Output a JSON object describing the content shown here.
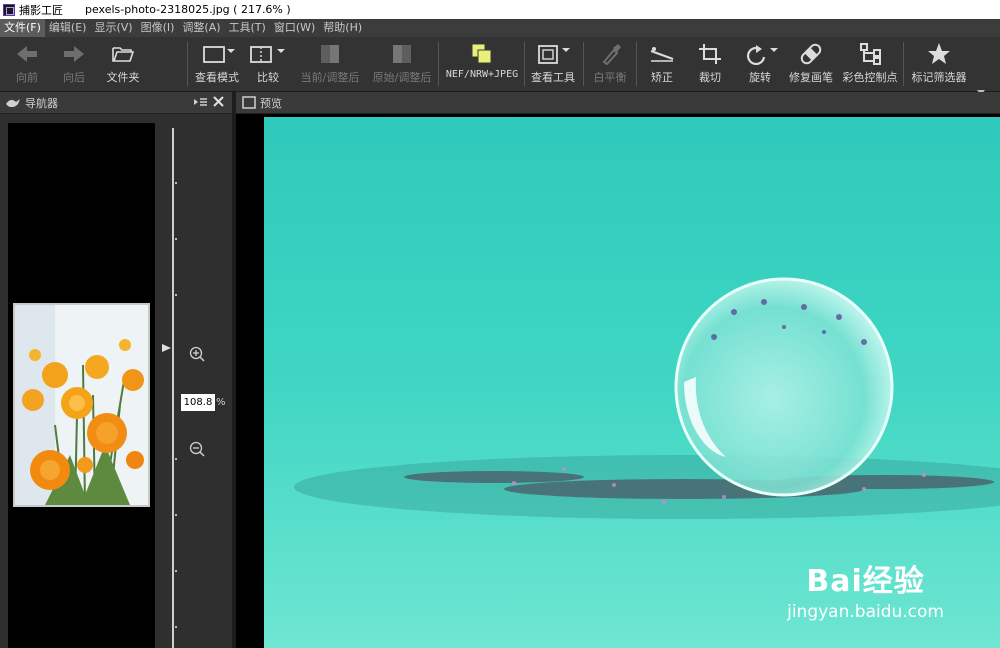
{
  "window": {
    "app_title": "捕影工匠",
    "file_title": "pexels-photo-2318025.jpg ( 217.6% )"
  },
  "menu": [
    {
      "label": "文件(F)",
      "active": true
    },
    {
      "label": "编辑(E)"
    },
    {
      "label": "显示(V)"
    },
    {
      "label": "图像(I)"
    },
    {
      "label": "调整(A)"
    },
    {
      "label": "工具(T)"
    },
    {
      "label": "窗口(W)"
    },
    {
      "label": "帮助(H)"
    }
  ],
  "toolbar": {
    "back": "向前",
    "forward": "向后",
    "folder": "文件夹",
    "view_mode": "查看模式",
    "compare": "比较",
    "current_adjusted": "当前/调整后",
    "original_adjusted": "原始/调整后",
    "nef_jpeg": "NEF/NRW+JPEG",
    "view_tools": "查看工具",
    "white_balance": "白平衡",
    "straighten": "矫正",
    "crop": "裁切",
    "rotate": "旋转",
    "retouch_brush": "修复画笔",
    "color_control_point": "彩色控制点",
    "label_filter": "标记筛选器"
  },
  "navigator": {
    "title": "导航器",
    "zoom_value": "108.8",
    "zoom_unit": "%"
  },
  "preview": {
    "title": "预览"
  },
  "watermark": {
    "brand": "Bai经验",
    "url": "jingyan.baidu.com"
  },
  "colors": {
    "accent_yellow": "#e9ef7a",
    "preview_bg": "#3fd6c2"
  }
}
